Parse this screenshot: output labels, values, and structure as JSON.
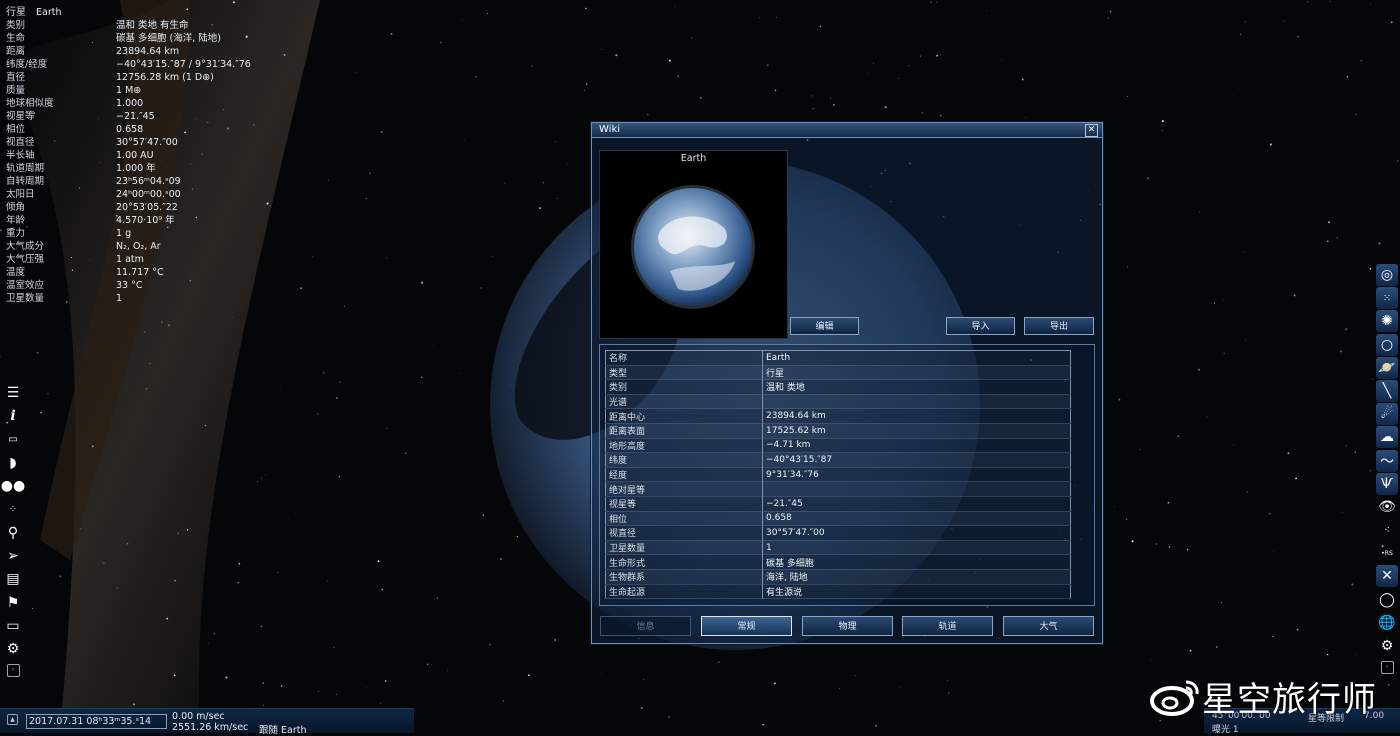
{
  "info_panel": [
    {
      "key": "行星",
      "value": "Earth"
    },
    {
      "key": "类别",
      "value": "温和 类地 有生命"
    },
    {
      "key": "生命",
      "value": "碳基 多细胞 (海洋, 陆地)"
    },
    {
      "key": "距离",
      "value": "23894.64 km"
    },
    {
      "key": "纬度/经度",
      "value": "−40°43′15.″87 / 9°31′34.″76"
    },
    {
      "key": "直径",
      "value": "12756.28 km (1 D⊕)"
    },
    {
      "key": "质量",
      "value": "1 M⊕"
    },
    {
      "key": "地球相似度",
      "value": "1.000"
    },
    {
      "key": "视星等",
      "value": "−21.″45"
    },
    {
      "key": "相位",
      "value": "0.658"
    },
    {
      "key": "视直径",
      "value": "30°57′47.″00"
    },
    {
      "key": "半长轴",
      "value": "1.00 AU"
    },
    {
      "key": "轨道周期",
      "value": "1.000 年"
    },
    {
      "key": "自转周期",
      "value": "23ʰ56ᵐ04.ˢ09"
    },
    {
      "key": "太阳日",
      "value": "24ʰ00ᵐ00.ˢ00"
    },
    {
      "key": "倾角",
      "value": "20°53′05.″22"
    },
    {
      "key": "年龄",
      "value": "4.570·10⁹ 年"
    },
    {
      "key": "重力",
      "value": "1 g"
    },
    {
      "key": "大气成分",
      "value": "N₂, O₂, Ar"
    },
    {
      "key": "大气压强",
      "value": "1 atm"
    },
    {
      "key": "温度",
      "value": "11.717 °C"
    },
    {
      "key": "温室效应",
      "value": "33 °C"
    },
    {
      "key": "卫星数量",
      "value": "1"
    }
  ],
  "left_toolbar": [
    "menu-icon",
    "info-icon",
    "ruler-icon",
    "planet-system-icon",
    "moons-icon",
    "stars-icon",
    "search-icon",
    "spaceship-icon",
    "script-icon",
    "flag-icon",
    "monitor-icon",
    "gear-icon",
    "small-settings-icon"
  ],
  "right_toolbar": [
    "galaxy-icon",
    "stars-field-icon",
    "nebula-icon",
    "ring-icon",
    "planet-ring-icon",
    "orbit-icon",
    "comet-icon",
    "cloud-icon",
    "wave-icon",
    "aurora-icon",
    "eye-icon",
    "sparkle-icon",
    "rs-labels-icon",
    "grid-arrows-icon",
    "circle-icon",
    "globe-icon",
    "gear-icon",
    "small-settings-icon"
  ],
  "bottom_bar": {
    "datetime": "2017.07.31 08ʰ33ᵐ35.ˢ14",
    "speed1": "0.00 m/sec",
    "speed2": "2551.26 km/sec",
    "follow": "跟随 Earth"
  },
  "bottom_right": {
    "fov": "45°00′00.″00",
    "mag_label": "星等限制",
    "mag_value": "7.00",
    "exposure": "曝光 1"
  },
  "watermark": "星空旅行师",
  "wiki": {
    "title": "Wiki",
    "preview_caption": "Earth",
    "edit_button": "编辑",
    "import_button": "导入",
    "export_button": "导出",
    "properties": [
      {
        "key": "名称",
        "value": "Earth"
      },
      {
        "key": "类型",
        "value": "行星"
      },
      {
        "key": "类别",
        "value": "温和 类地"
      },
      {
        "key": "光谱",
        "value": ""
      },
      {
        "key": "距离中心",
        "value": "23894.64 km"
      },
      {
        "key": "距离表面",
        "value": "17525.62 km"
      },
      {
        "key": "地形高度",
        "value": "−4.71 km"
      },
      {
        "key": "纬度",
        "value": "−40°43′15.″87"
      },
      {
        "key": "经度",
        "value": "9°31′34.″76"
      },
      {
        "key": "绝对星等",
        "value": ""
      },
      {
        "key": "视星等",
        "value": "−21.″45"
      },
      {
        "key": "相位",
        "value": "0.658"
      },
      {
        "key": "视直径",
        "value": "30°57′47.″00"
      },
      {
        "key": "卫星数量",
        "value": "1"
      },
      {
        "key": "生命形式",
        "value": "碳基 多细胞"
      },
      {
        "key": "生物群系",
        "value": "海洋, 陆地"
      },
      {
        "key": "生命起源",
        "value": "有生源说"
      }
    ],
    "tabs": [
      {
        "label": "信息",
        "state": "disabled"
      },
      {
        "label": "常规",
        "state": "selected"
      },
      {
        "label": "物理",
        "state": "normal"
      },
      {
        "label": "轨道",
        "state": "normal"
      },
      {
        "label": "大气",
        "state": "normal"
      }
    ]
  },
  "colors": {
    "panel": "#0e223e",
    "accent": "#8aa3c2",
    "ocean": "#3f6fa8"
  }
}
